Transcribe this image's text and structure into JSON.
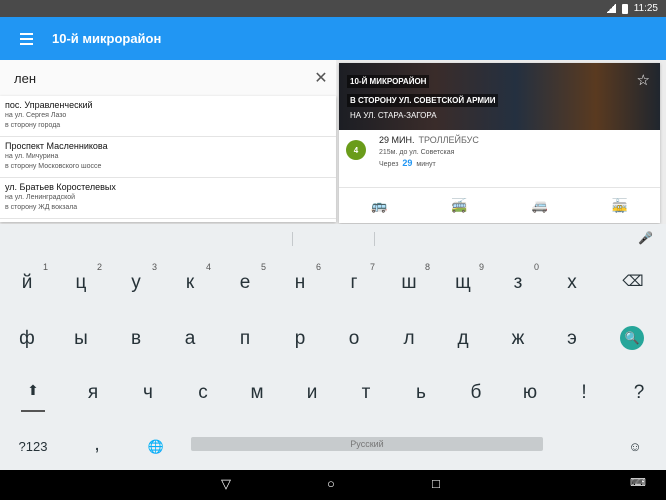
{
  "status": {
    "time": "11:25"
  },
  "appbar": {
    "title": "10-й микрорайон"
  },
  "search": {
    "query": "лен",
    "clear_icon": "✕"
  },
  "suggestions": [
    {
      "name": "пос. Управленческий",
      "street": "на ул. Сергея Лазо",
      "direction": "в сторону города"
    },
    {
      "name": "Проспект Масленникова",
      "street": "на ул. Мичурина",
      "direction": "в сторону Московского шоссе"
    },
    {
      "name": "ул. Братьев Коростелевых",
      "street": "на ул. Ленинградской",
      "direction": "в сторону ЖД вокзала"
    }
  ],
  "stop_card": {
    "title": "10-Й МИКРОРАЙОН",
    "direction": "В СТОРОНУ УЛ. СОВЕТСКОЙ АРМИИ",
    "street": "НА УЛ. СТАРА-ЗАГОРА",
    "route_number": "4",
    "eta": "29 МИН.",
    "transport_type": "ТРОЛЛЕЙБУС",
    "distance": "215м. до ул. Советская",
    "via_prefix": "Через",
    "via_value": "29",
    "via_suffix": "минут",
    "accent_color": "#2196f3",
    "badge_color": "#6a9c1a"
  },
  "keyboard": {
    "row1": [
      {
        "ch": "й",
        "hint": "1"
      },
      {
        "ch": "ц",
        "hint": "2"
      },
      {
        "ch": "у",
        "hint": "3"
      },
      {
        "ch": "к",
        "hint": "4"
      },
      {
        "ch": "е",
        "hint": "5"
      },
      {
        "ch": "н",
        "hint": "6"
      },
      {
        "ch": "г",
        "hint": "7"
      },
      {
        "ch": "ш",
        "hint": "8"
      },
      {
        "ch": "щ",
        "hint": "9"
      },
      {
        "ch": "з",
        "hint": "0"
      },
      {
        "ch": "х",
        "hint": ""
      }
    ],
    "row2": [
      "ф",
      "ы",
      "в",
      "а",
      "п",
      "р",
      "о",
      "л",
      "д",
      "ж",
      "э"
    ],
    "row3": [
      "я",
      "ч",
      "с",
      "м",
      "и",
      "т",
      "ь",
      "б",
      "ю",
      "!",
      "?"
    ],
    "symbols_label": "?123",
    "comma": ",",
    "space_label": "Русский"
  }
}
